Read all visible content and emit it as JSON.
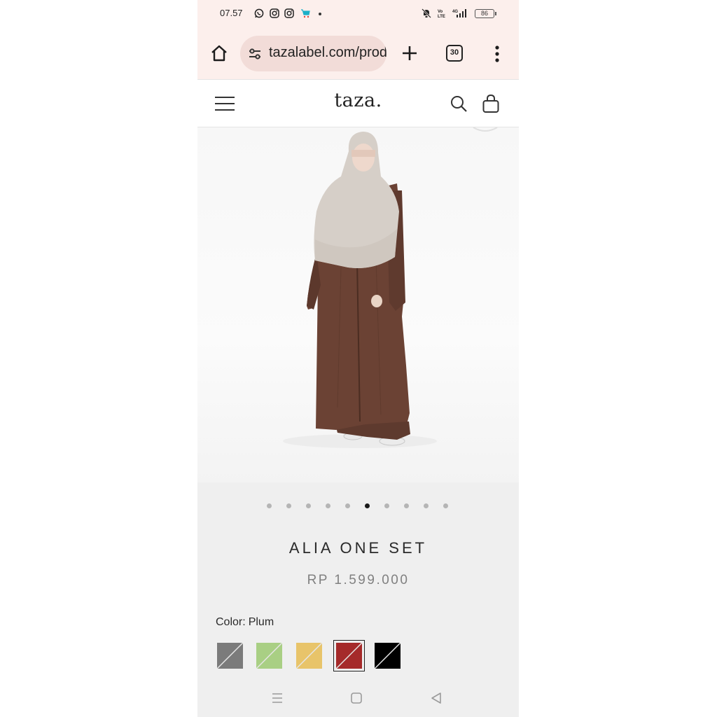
{
  "status_bar": {
    "time": "07.57",
    "battery": "86",
    "icons": [
      "whatsapp-icon",
      "instagram-icon",
      "instagram-icon",
      "shop-icon",
      "notification-dot",
      "mute-icon",
      "volte-icon",
      "signal-4g-icon",
      "battery-icon"
    ]
  },
  "browser": {
    "url": "tazalabel.com/products/alia-one-set",
    "tab_count": "30",
    "icons": [
      "home-icon",
      "site-settings-icon",
      "new-tab-plus-icon",
      "tab-switcher-icon",
      "more-vert-icon"
    ]
  },
  "site": {
    "logo": "taza.",
    "icons": [
      "hamburger-menu-icon",
      "search-icon",
      "shopping-bag-icon"
    ]
  },
  "product": {
    "title": "ALIA ONE SET",
    "price": "RP 1.599.000",
    "color_label": "Color:",
    "color_value": "Plum",
    "image_count": 10,
    "active_image": 6,
    "swatches": [
      {
        "name": "Grey",
        "color": "#7b7b7b",
        "selected": false
      },
      {
        "name": "Sage",
        "color": "#a9cf84",
        "selected": false
      },
      {
        "name": "Mustard",
        "color": "#e8c46a",
        "selected": false
      },
      {
        "name": "Plum",
        "color": "#a52a2a",
        "selected": true
      },
      {
        "name": "Black",
        "color": "#000000",
        "selected": false
      }
    ]
  },
  "colors": {
    "browser_chrome": "#fcefec",
    "url_pill": "#f2dcd8",
    "page_bg": "#efefef",
    "dress": "#6e4436",
    "khimar": "#d2cbc4"
  },
  "system_nav": {
    "icons": [
      "recents-icon",
      "home-square-icon",
      "back-triangle-icon"
    ]
  }
}
